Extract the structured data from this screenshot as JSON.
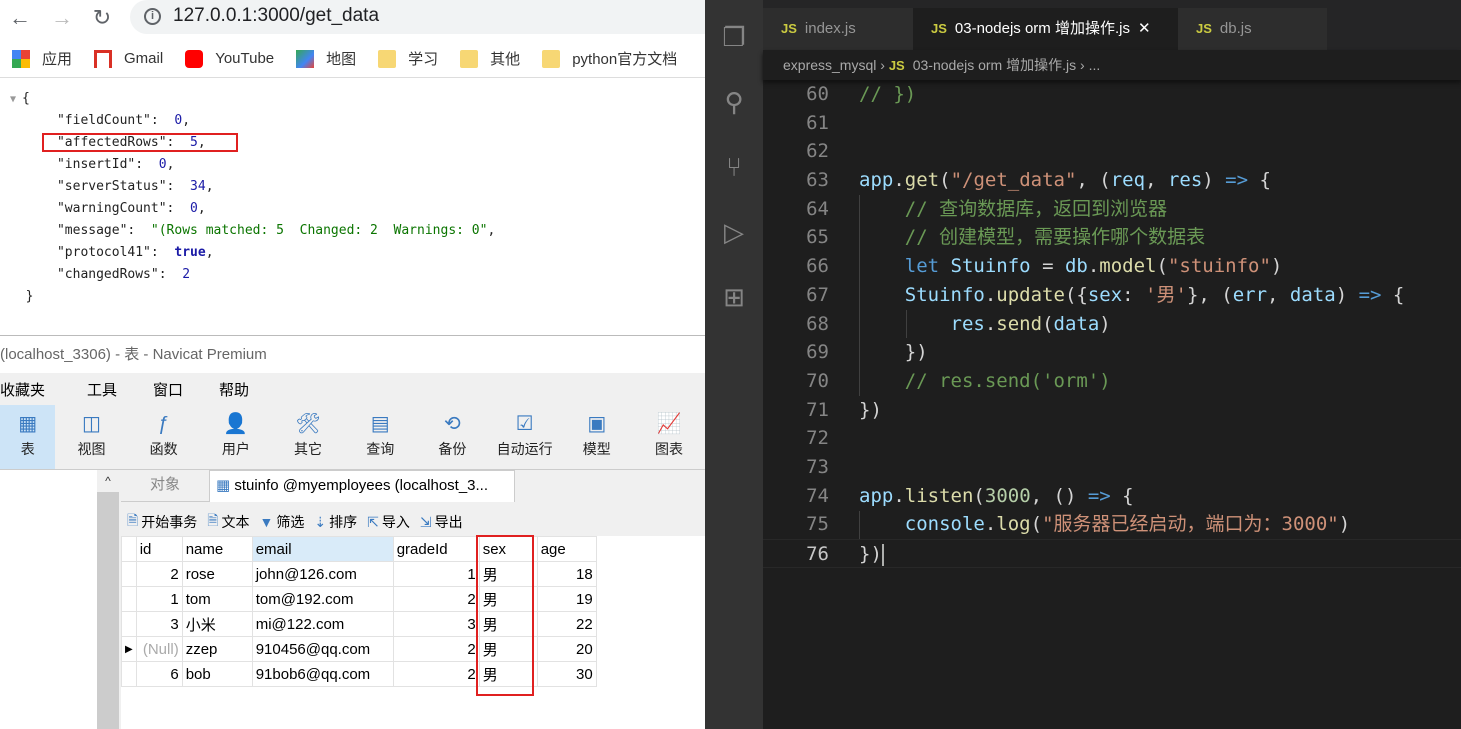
{
  "browser": {
    "url": "127.0.0.1:3000/get_data",
    "bookmarks": [
      {
        "label": "应用",
        "icon": "apps-grid-icon"
      },
      {
        "label": "Gmail",
        "icon": "gmail-icon"
      },
      {
        "label": "YouTube",
        "icon": "youtube-icon"
      },
      {
        "label": "地图",
        "icon": "maps-icon"
      },
      {
        "label": "学习",
        "icon": "folder-icon"
      },
      {
        "label": "其他",
        "icon": "folder-icon"
      },
      {
        "label": "python官方文档",
        "icon": "folder-icon"
      }
    ],
    "json": {
      "open": "{",
      "close": "}",
      "entries": [
        {
          "key": "\"fieldCount\"",
          "value": "0",
          "type": "num",
          "comma": ","
        },
        {
          "key": "\"affectedRows\"",
          "value": "5",
          "type": "num",
          "comma": ","
        },
        {
          "key": "\"insertId\"",
          "value": "0",
          "type": "num",
          "comma": ","
        },
        {
          "key": "\"serverStatus\"",
          "value": "34",
          "type": "num",
          "comma": ","
        },
        {
          "key": "\"warningCount\"",
          "value": "0",
          "type": "num",
          "comma": ","
        },
        {
          "key": "\"message\"",
          "value": "\"(Rows matched: 5  Changed: 2  Warnings: 0\"",
          "type": "str",
          "comma": ","
        },
        {
          "key": "\"protocol41\"",
          "value": "true",
          "type": "bool",
          "comma": ","
        },
        {
          "key": "\"changedRows\"",
          "value": "2",
          "type": "num",
          "comma": ""
        }
      ]
    }
  },
  "navicat": {
    "title": "(localhost_3306) - 表 - Navicat Premium",
    "menu": [
      "收藏夹",
      "工具",
      "窗口",
      "帮助"
    ],
    "toolbar": [
      {
        "label": "表",
        "icon": "table-icon"
      },
      {
        "label": "视图",
        "icon": "view-icon"
      },
      {
        "label": "函数",
        "icon": "function-icon"
      },
      {
        "label": "用户",
        "icon": "user-icon"
      },
      {
        "label": "其它",
        "icon": "tools-icon"
      },
      {
        "label": "查询",
        "icon": "query-icon"
      },
      {
        "label": "备份",
        "icon": "backup-icon"
      },
      {
        "label": "自动运行",
        "icon": "schedule-icon"
      },
      {
        "label": "模型",
        "icon": "model-icon"
      },
      {
        "label": "图表",
        "icon": "chart-icon"
      }
    ],
    "tabs": [
      "对象",
      "stuinfo @myemployees (localhost_3..."
    ],
    "actions": [
      "开始事务",
      "文本",
      "筛选",
      "排序",
      "导入",
      "导出"
    ],
    "columns": [
      "id",
      "name",
      "email",
      "gradeId",
      "sex",
      "age"
    ],
    "rows": [
      [
        "2",
        "rose",
        "john@126.com",
        "1",
        "男",
        "18"
      ],
      [
        "1",
        "tom",
        "tom@192.com",
        "2",
        "男",
        "19"
      ],
      [
        "3",
        "小米",
        "mi@122.com",
        "3",
        "男",
        "22"
      ],
      [
        "(Null)",
        "zzep",
        "910456@qq.com",
        "2",
        "男",
        "20"
      ],
      [
        "6",
        "bob",
        "91bob6@qq.com",
        "2",
        "男",
        "30"
      ]
    ]
  },
  "vscode": {
    "tabs": [
      {
        "label": "index.js"
      },
      {
        "label": "03-nodejs orm 增加操作.js"
      },
      {
        "label": "db.js"
      }
    ],
    "breadcrumb": [
      "express_mysql",
      "03-nodejs orm 增加操作.js",
      "..."
    ],
    "lines": [
      {
        "n": "60",
        "t": [
          [
            "c",
            "// })"
          ]
        ]
      },
      {
        "n": "61",
        "t": []
      },
      {
        "n": "62",
        "t": []
      },
      {
        "n": "63",
        "t": [
          [
            "v",
            "app"
          ],
          [
            "p",
            "."
          ],
          [
            "f",
            "get"
          ],
          [
            "p",
            "("
          ],
          [
            "s",
            "\"/get_data\""
          ],
          [
            "p",
            ", ("
          ],
          [
            "v",
            "req"
          ],
          [
            "p",
            ", "
          ],
          [
            "v",
            "res"
          ],
          [
            "p",
            ") "
          ],
          [
            "k",
            "=>"
          ],
          [
            "p",
            " {"
          ]
        ]
      },
      {
        "n": "64",
        "t": [
          [
            "p",
            "    "
          ],
          [
            "c",
            "// 查询数据库，返回到浏览器"
          ]
        ]
      },
      {
        "n": "65",
        "t": [
          [
            "p",
            "    "
          ],
          [
            "c",
            "// 创建模型，需要操作哪个数据表"
          ]
        ]
      },
      {
        "n": "66",
        "t": [
          [
            "p",
            "    "
          ],
          [
            "k",
            "let"
          ],
          [
            "p",
            " "
          ],
          [
            "v",
            "Stuinfo"
          ],
          [
            "p",
            " = "
          ],
          [
            "v",
            "db"
          ],
          [
            "p",
            "."
          ],
          [
            "f",
            "model"
          ],
          [
            "p",
            "("
          ],
          [
            "s",
            "\"stuinfo\""
          ],
          [
            "p",
            ")"
          ]
        ]
      },
      {
        "n": "67",
        "t": [
          [
            "p",
            "    "
          ],
          [
            "v",
            "Stuinfo"
          ],
          [
            "p",
            "."
          ],
          [
            "f",
            "update"
          ],
          [
            "p",
            "({"
          ],
          [
            "v",
            "sex"
          ],
          [
            "p",
            ": "
          ],
          [
            "s",
            "'男'"
          ],
          [
            "p",
            "}, ("
          ],
          [
            "v",
            "err"
          ],
          [
            "p",
            ", "
          ],
          [
            "v",
            "data"
          ],
          [
            "p",
            ") "
          ],
          [
            "k",
            "=>"
          ],
          [
            "p",
            " {"
          ]
        ]
      },
      {
        "n": "68",
        "t": [
          [
            "p",
            "        "
          ],
          [
            "v",
            "res"
          ],
          [
            "p",
            "."
          ],
          [
            "f",
            "send"
          ],
          [
            "p",
            "("
          ],
          [
            "v",
            "data"
          ],
          [
            "p",
            ")"
          ]
        ]
      },
      {
        "n": "69",
        "t": [
          [
            "p",
            "    })"
          ]
        ]
      },
      {
        "n": "70",
        "t": [
          [
            "p",
            "    "
          ],
          [
            "c",
            "// res.send('orm')"
          ]
        ]
      },
      {
        "n": "71",
        "t": [
          [
            "p",
            "})"
          ]
        ]
      },
      {
        "n": "72",
        "t": []
      },
      {
        "n": "73",
        "t": []
      },
      {
        "n": "74",
        "t": [
          [
            "v",
            "app"
          ],
          [
            "p",
            "."
          ],
          [
            "f",
            "listen"
          ],
          [
            "p",
            "("
          ],
          [
            "n",
            "3000"
          ],
          [
            "p",
            ", () "
          ],
          [
            "k",
            "=>"
          ],
          [
            "p",
            " {"
          ]
        ]
      },
      {
        "n": "75",
        "t": [
          [
            "p",
            "    "
          ],
          [
            "v",
            "console"
          ],
          [
            "p",
            "."
          ],
          [
            "f",
            "log"
          ],
          [
            "p",
            "("
          ],
          [
            "s",
            "\"服务器已经启动，端口为：3000\""
          ],
          [
            "p",
            ")"
          ]
        ]
      },
      {
        "n": "76",
        "t": [
          [
            "p",
            "})"
          ]
        ]
      }
    ]
  },
  "colors": {
    "highlight_box": "#e02020",
    "vscode_bg": "#1e1e1e",
    "json_number": "#1a1aa6",
    "json_string": "#0b7500"
  }
}
